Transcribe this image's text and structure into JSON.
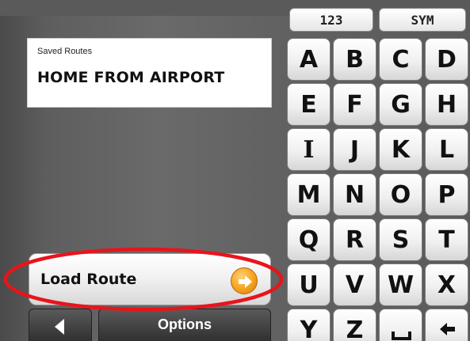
{
  "info": {
    "small_label": "Saved Routes",
    "value": "HOME FROM AIRPORT"
  },
  "load_button": {
    "label": "Load Route",
    "icon": "right-arrow-circle-icon"
  },
  "bottom_nav": {
    "back_icon": "left-arrow-icon",
    "options_label": "Options"
  },
  "keyboard": {
    "modes": [
      "123",
      "SYM"
    ],
    "rows": [
      [
        "A",
        "B",
        "C",
        "D"
      ],
      [
        "E",
        "F",
        "G",
        "H"
      ],
      [
        "I",
        "J",
        "K",
        "L"
      ],
      [
        "M",
        "N",
        "O",
        "P"
      ],
      [
        "Q",
        "R",
        "S",
        "T"
      ],
      [
        "U",
        "V",
        "W",
        "X"
      ],
      [
        "Y",
        "Z",
        "",
        ""
      ]
    ],
    "special_keys": [
      "space-icon",
      "backspace-icon"
    ]
  },
  "colors": {
    "annotation": "#e8141c",
    "accent_orange": "#f5a21a",
    "background": "#616161"
  }
}
